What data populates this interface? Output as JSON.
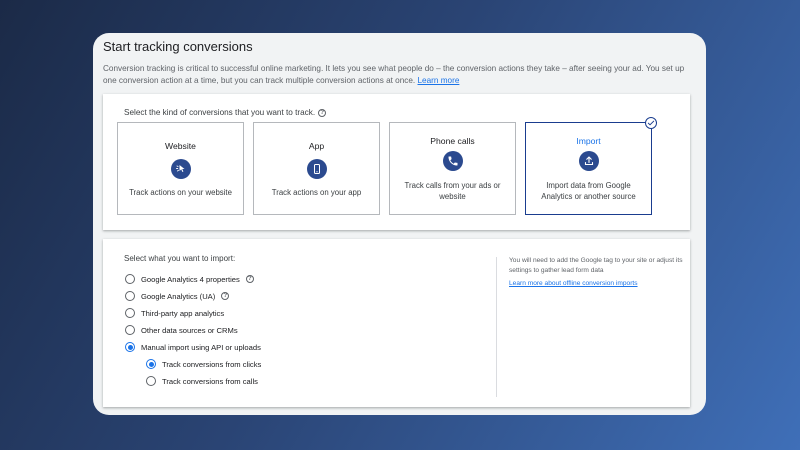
{
  "page": {
    "title": "Start tracking conversions",
    "intro": "Conversion tracking is critical to successful online marketing. It lets you see what people do – the conversion actions they take – after seeing your ad. You set up one conversion action at a time, but you can track multiple conversion actions at once.",
    "learn_more": "Learn more"
  },
  "conversion_types": {
    "label": "Select the kind of conversions that you want to track.",
    "tiles": [
      {
        "name": "Website",
        "icon": "cursor-click-icon",
        "desc": "Track actions on your website",
        "selected": false
      },
      {
        "name": "App",
        "icon": "mobile-phone-icon",
        "desc": "Track actions on your app",
        "selected": false
      },
      {
        "name": "Phone calls",
        "icon": "phone-icon",
        "desc": "Track calls from your ads or website",
        "selected": false
      },
      {
        "name": "Import",
        "icon": "upload-icon",
        "desc": "Import data from Google Analytics or another source",
        "selected": true
      }
    ]
  },
  "import": {
    "label": "Select what you want to import:",
    "options": [
      {
        "label": "Google Analytics 4 properties",
        "help": true,
        "checked": false
      },
      {
        "label": "Google Analytics (UA)",
        "help": true,
        "checked": false
      },
      {
        "label": "Third-party app analytics",
        "help": false,
        "checked": false
      },
      {
        "label": "Other data sources or CRMs",
        "help": false,
        "checked": false
      },
      {
        "label": "Manual import using API or uploads",
        "help": false,
        "checked": true
      }
    ],
    "sub_options": [
      {
        "label": "Track conversions from clicks",
        "checked": true
      },
      {
        "label": "Track conversions from calls",
        "checked": false
      }
    ],
    "side_note": "You will need to add the Google tag to your site or adjust its settings to gather lead form data",
    "side_link": "Learn more about offline conversion imports"
  },
  "colors": {
    "accent": "#1a73e8",
    "icon_bg": "#2b4a8f",
    "selected_border": "#1a3d8f"
  }
}
